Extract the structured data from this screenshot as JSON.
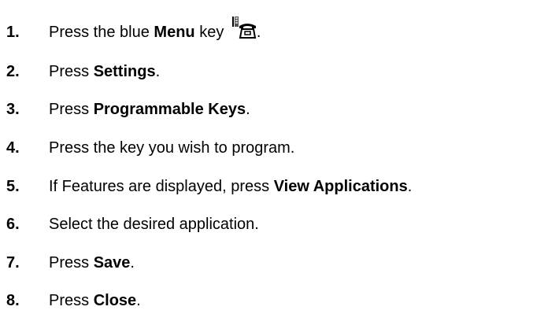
{
  "steps": [
    {
      "number": "1.",
      "parts": [
        {
          "text": "Press the blue ",
          "bold": false
        },
        {
          "text": "Menu",
          "bold": true
        },
        {
          "text": " key ",
          "bold": false
        }
      ],
      "icon": "phone-menu-icon",
      "suffix": "."
    },
    {
      "number": "2.",
      "parts": [
        {
          "text": "Press ",
          "bold": false
        },
        {
          "text": "Settings",
          "bold": true
        },
        {
          "text": ".",
          "bold": false
        }
      ]
    },
    {
      "number": "3.",
      "parts": [
        {
          "text": "Press ",
          "bold": false
        },
        {
          "text": "Programmable Keys",
          "bold": true
        },
        {
          "text": ".",
          "bold": false
        }
      ]
    },
    {
      "number": "4.",
      "parts": [
        {
          "text": "Press the key you wish to program.",
          "bold": false
        }
      ]
    },
    {
      "number": "5.",
      "parts": [
        {
          "text": "If Features are displayed, press ",
          "bold": false
        },
        {
          "text": "View Applications",
          "bold": true
        },
        {
          "text": ".",
          "bold": false
        }
      ]
    },
    {
      "number": "6.",
      "parts": [
        {
          "text": "Select the desired application.",
          "bold": false
        }
      ]
    },
    {
      "number": "7.",
      "parts": [
        {
          "text": "Press ",
          "bold": false
        },
        {
          "text": "Save",
          "bold": true
        },
        {
          "text": ".",
          "bold": false
        }
      ]
    },
    {
      "number": "8.",
      "parts": [
        {
          "text": "Press ",
          "bold": false
        },
        {
          "text": "Close",
          "bold": true
        },
        {
          "text": ".",
          "bold": false
        }
      ]
    }
  ]
}
